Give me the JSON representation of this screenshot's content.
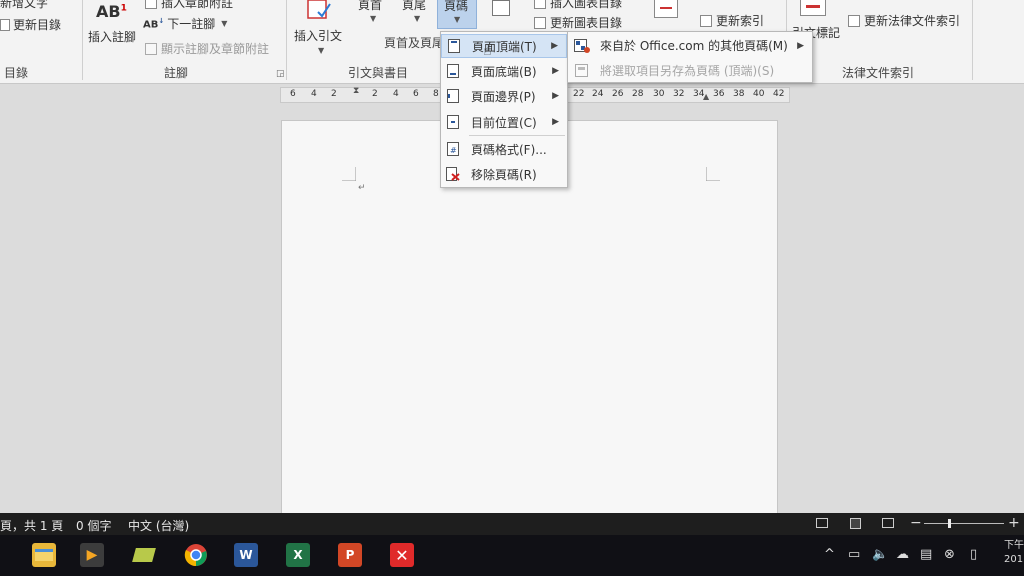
{
  "ribbon": {
    "toc_group": {
      "add_text": "新增文字",
      "update_toc": "更新目錄",
      "label": "目錄"
    },
    "footnotes_group": {
      "ab_icon_text": "AB",
      "ab_superscript": "1",
      "insert_footnote": "插入註腳",
      "insert_endnote": "插入章節附註",
      "next_footnote": "下一註腳",
      "show_notes": "顯示註腳及章節附註",
      "label": "註腳"
    },
    "citations_group": {
      "insert_citation": "插入引文",
      "label": "引文與書目"
    },
    "header_footer_group": {
      "header": "頁首",
      "footer": "頁尾",
      "page_number": "頁碼",
      "label": "頁首及頁尾"
    },
    "captions_group": {
      "insert_table_of_figures": "插入圖表目錄",
      "update_table": "更新圖表目錄"
    },
    "index_group": {
      "update_index": "更新索引"
    },
    "table_of_authorities_group": {
      "mark_citation": "引文標記",
      "update_table": "更新法律文件索引",
      "label": "法律文件索引"
    }
  },
  "ruler": {
    "ticks": [
      "6",
      "4",
      "2",
      "2",
      "4",
      "6",
      "8",
      "22",
      "24",
      "26",
      "28",
      "30",
      "32",
      "34",
      "36",
      "38",
      "40",
      "42"
    ]
  },
  "page_number_menu": {
    "items": [
      {
        "label": "頁面頂端(T)",
        "has_submenu": true,
        "icon": "page-top-icon"
      },
      {
        "label": "頁面底端(B)",
        "has_submenu": true,
        "icon": "page-bottom-icon"
      },
      {
        "label": "頁面邊界(P)",
        "has_submenu": true,
        "icon": "page-margin-icon"
      },
      {
        "label": "目前位置(C)",
        "has_submenu": true,
        "icon": "current-position-icon"
      },
      {
        "label": "頁碼格式(F)...",
        "has_submenu": false,
        "icon": "page-number-format-icon"
      },
      {
        "label": "移除頁碼(R)",
        "has_submenu": false,
        "icon": "remove-page-number-icon"
      }
    ]
  },
  "submenu": {
    "items": [
      {
        "label": "來自於 Office.com 的其他頁碼(M)",
        "enabled": true
      },
      {
        "label": "將選取項目另存為頁碼 (頂端)(S)",
        "enabled": false
      }
    ]
  },
  "status_bar": {
    "page": "頁，共 1 頁",
    "word_count": "0 個字",
    "language": "中文 (台灣)",
    "clock_top": "下午",
    "clock_bottom": "201"
  },
  "taskbar": {
    "apps": [
      {
        "name": "file-explorer",
        "letter": ""
      },
      {
        "name": "media-player",
        "letter": ""
      },
      {
        "name": "onenote-like",
        "letter": ""
      },
      {
        "name": "chrome",
        "letter": ""
      },
      {
        "name": "word",
        "letter": "W"
      },
      {
        "name": "excel",
        "letter": "X"
      },
      {
        "name": "powerpoint",
        "letter": "P"
      },
      {
        "name": "xmind",
        "letter": ""
      }
    ]
  },
  "colors": {
    "ribbon_bg": "#f3f3f3",
    "menu_highlight": "#d5e4f5",
    "word_blue": "#2b579a",
    "excel_green": "#217346",
    "ppt_red": "#d24726",
    "xmind_red": "#e02a2a"
  }
}
